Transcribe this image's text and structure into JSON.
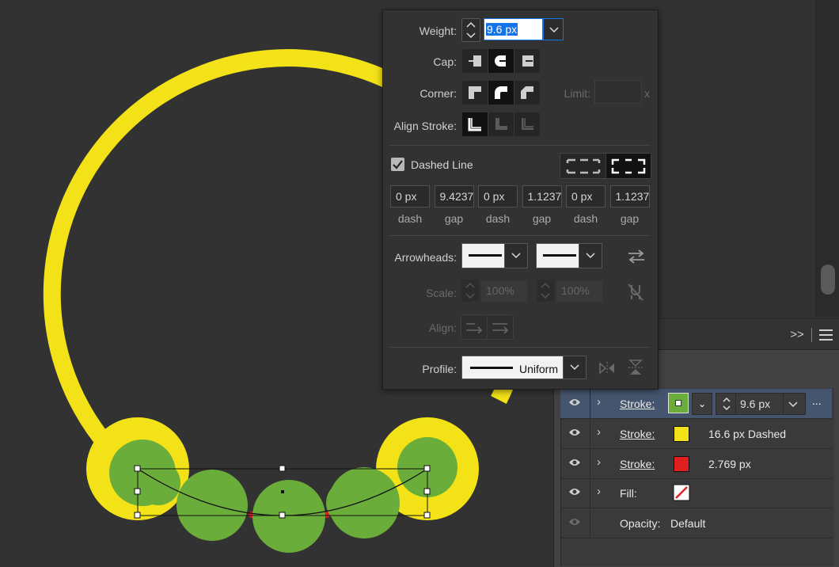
{
  "canvas": {
    "colors": {
      "background": "#323232",
      "ring": "#f2e217",
      "green": "#6aad3a",
      "red_stroke": "#e02020",
      "selection": "#000000"
    }
  },
  "stroke_panel": {
    "weight_label": "Weight:",
    "weight_value": "9.6 px",
    "cap_label": "Cap:",
    "corner_label": "Corner:",
    "limit_label": "Limit:",
    "limit_suffix": "x",
    "align_stroke_label": "Align Stroke:",
    "dashed_line_label": "Dashed Line",
    "dashed_checked": true,
    "dash_fields": [
      {
        "value": "0 px",
        "label": "dash"
      },
      {
        "value": "9.4237",
        "label": "gap"
      },
      {
        "value": "0 px",
        "label": "dash"
      },
      {
        "value": "1.1237",
        "label": "gap"
      },
      {
        "value": "0 px",
        "label": "dash"
      },
      {
        "value": "1.1237",
        "label": "gap"
      }
    ],
    "arrowheads_label": "Arrowheads:",
    "scale_label": "Scale:",
    "scale_start": "100%",
    "scale_end": "100%",
    "align_label": "Align:",
    "profile_label": "Profile:",
    "profile_value": "Uniform"
  },
  "appearance_panel": {
    "rows": [
      {
        "label": "Stroke:",
        "value": "9.6 px",
        "swatch": "#6aad3a",
        "selected": true
      },
      {
        "label": "Stroke:",
        "value": "16.6 px Dashed",
        "swatch": "#f2e217"
      },
      {
        "label": "Stroke:",
        "value": "2.769 px",
        "swatch": "#e02020"
      },
      {
        "label": "Fill:",
        "value": "",
        "swatch": "none"
      },
      {
        "label": "Opacity:",
        "value": "Default"
      }
    ],
    "more_label": "..."
  }
}
